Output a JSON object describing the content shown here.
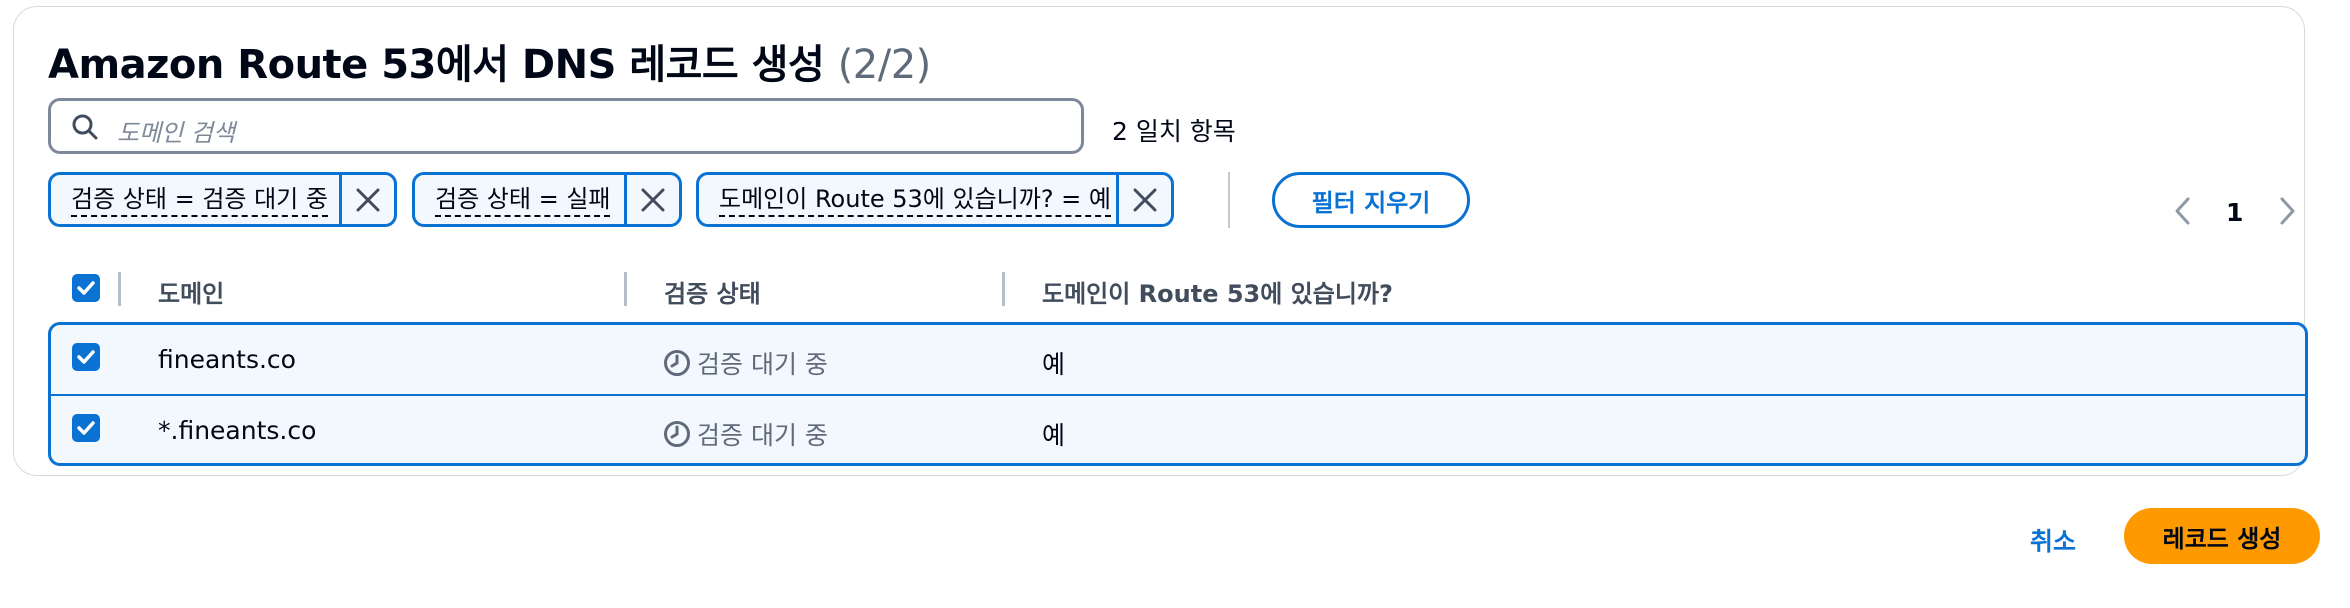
{
  "header": {
    "title": "Amazon Route 53에서 DNS 레코드 생성",
    "count": "(2/2)"
  },
  "search": {
    "placeholder": "도메인 검색",
    "match_count": "2 일치 항목"
  },
  "filters": [
    {
      "label": "검증 상태 = 검증 대기 중"
    },
    {
      "label": "검증 상태 = 실패"
    },
    {
      "label": "도메인이 Route 53에 있습니까? = 예"
    }
  ],
  "clear_filters_label": "필터 지우기",
  "pagination": {
    "current_page": "1"
  },
  "table": {
    "columns": [
      "도메인",
      "검증 상태",
      "도메인이 Route 53에 있습니까?"
    ],
    "rows": [
      {
        "domain": "fineants.co",
        "status": "검증 대기 중",
        "in_route53": "예",
        "selected": true
      },
      {
        "domain": "*.fineants.co",
        "status": "검증 대기 중",
        "in_route53": "예",
        "selected": true
      }
    ],
    "select_all": true
  },
  "actions": {
    "cancel_label": "취소",
    "create_label": "레코드 생성"
  },
  "colors": {
    "accent": "#0972d3",
    "primary_button": "#ff9900",
    "row_selected_bg": "#f2f8fd"
  }
}
